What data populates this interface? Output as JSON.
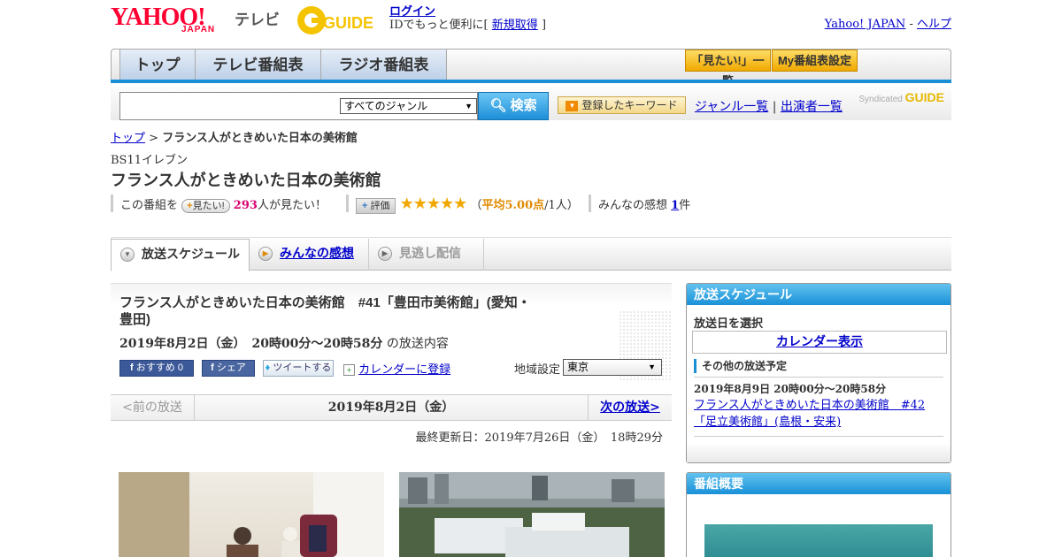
{
  "header": {
    "yahoo_logo": "YAHOO!",
    "yahoo_sub": "JAPAN",
    "tv_label": "テレビ",
    "gguide_logo": "G GUIDE",
    "login_label": "ログイン",
    "login_text": "IDでもっと便利に[",
    "register_label": "新規取得",
    "login_suffix": "]",
    "yahoo_japan_link": "Yahoo! JAPAN",
    "dash": " - ",
    "help_link": "ヘルプ"
  },
  "nav": {
    "tabs": [
      "トップ",
      "テレビ番組表",
      "ラジオ番組表"
    ],
    "mitai_list": "「見たい!」一覧",
    "my_program": "My番組表設定"
  },
  "search": {
    "input_value": "",
    "genre_selected": "すべてのジャンル",
    "search_button": "検索",
    "keyword_button": "登録したキーワード",
    "genre_list_link": "ジャンル一覧",
    "divider": "|",
    "performer_list_link": "出演者一覧",
    "syndicated": "Syndicated",
    "syndicated_logo": "GUIDE"
  },
  "breadcrumb": {
    "top": "トップ",
    "separator": " > ",
    "current": "フランス人がときめいた日本の美術館"
  },
  "program": {
    "channel": "BS11イレブン",
    "title": "フランス人がときめいた日本の美術館",
    "this_program": "この番組を",
    "mitai_button": "見たい!",
    "mitai_count": "293",
    "mitai_suffix": "人が見たい！",
    "eval_button": "評価",
    "stars": "★★★★★",
    "avg_open": "（",
    "avg_label": "平均5.00点",
    "avg_people": "/1人）",
    "impressions_label": "みんなの感想",
    "impressions_count": "1",
    "impressions_suffix": "件"
  },
  "tabs": {
    "schedule": "放送スケジュール",
    "impressions": "みんなの感想",
    "missed": "見逃し配信"
  },
  "episode": {
    "title": "フランス人がときめいた日本の美術館　#41「豊田市美術館」(愛知・豊田)",
    "datetime": "2019年8月2日（金）　20時00分～20時58分",
    "datetime_suffix": "の放送内容",
    "fb_recommend": "おすすめ 0",
    "fb_share": "シェア",
    "tweet": "ツイートする",
    "calendar_register": "カレンダーに登録",
    "region_label": "地域設定",
    "region_selected": "東京"
  },
  "pager": {
    "prev": "<前の放送",
    "current": "2019年8月2日（金）",
    "next": "次の放送>"
  },
  "updated": "最終更新日：2019年7月26日（金）　18時29分",
  "sidebar": {
    "schedule_header": "放送スケジュール",
    "select_date": "放送日を選択",
    "calendar_display": "カレンダー表示",
    "other_schedule": "その他の放送予定",
    "other_date": "2019年8月9日  20時00分～20時58分",
    "other_link": "フランス人がときめいた日本の美術館　#42「足立美術館」(島根・安来)",
    "overview_header": "番組概要"
  },
  "colors": {
    "accent_blue": "#1a8fd6",
    "yahoo_red": "#ff0033",
    "star_orange": "#f0a800",
    "count_pink": "#d6006e"
  }
}
